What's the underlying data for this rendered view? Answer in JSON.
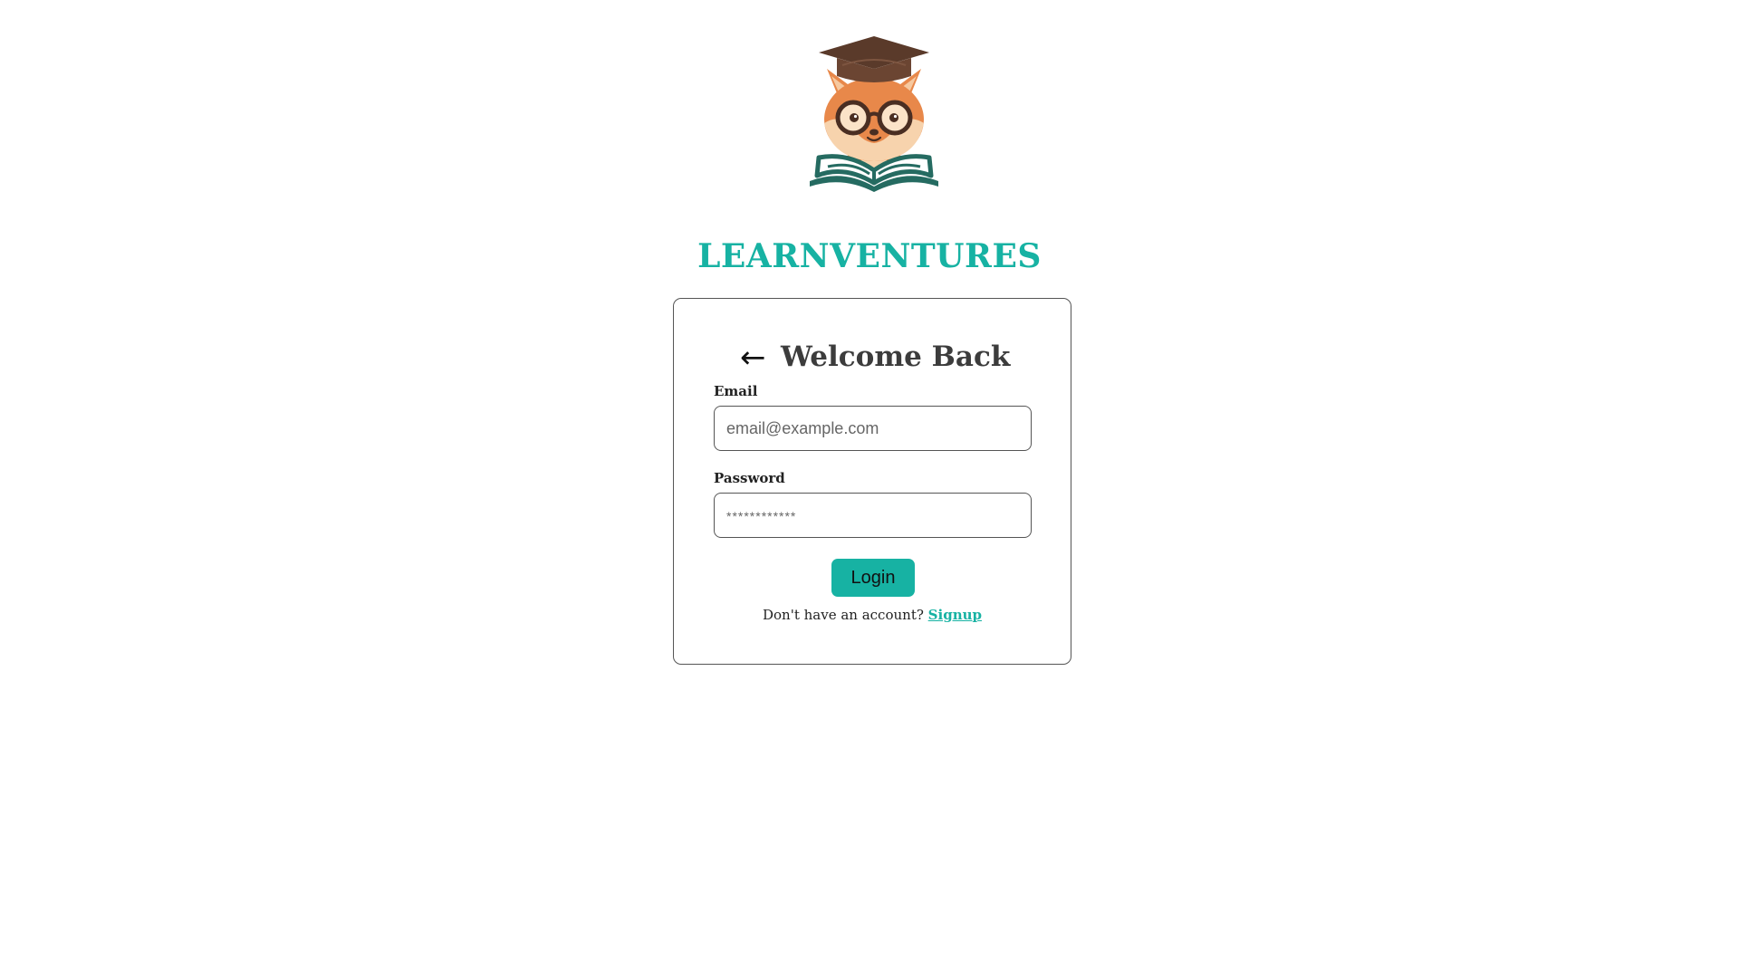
{
  "brand": {
    "name": "LEARNVENTURES",
    "logo_icon": "fox-owl-graduate-reading-book-icon",
    "color": "#17b2a3"
  },
  "login_card": {
    "back_icon": "arrow-left-icon",
    "back_glyph": "←",
    "title": "Welcome Back",
    "email": {
      "label": "Email",
      "placeholder": "email@example.com",
      "value": ""
    },
    "password": {
      "label": "Password",
      "placeholder": "************",
      "value": ""
    },
    "login_button": "Login",
    "signup_prompt": "Don't have an account?",
    "signup_link": "Signup"
  }
}
